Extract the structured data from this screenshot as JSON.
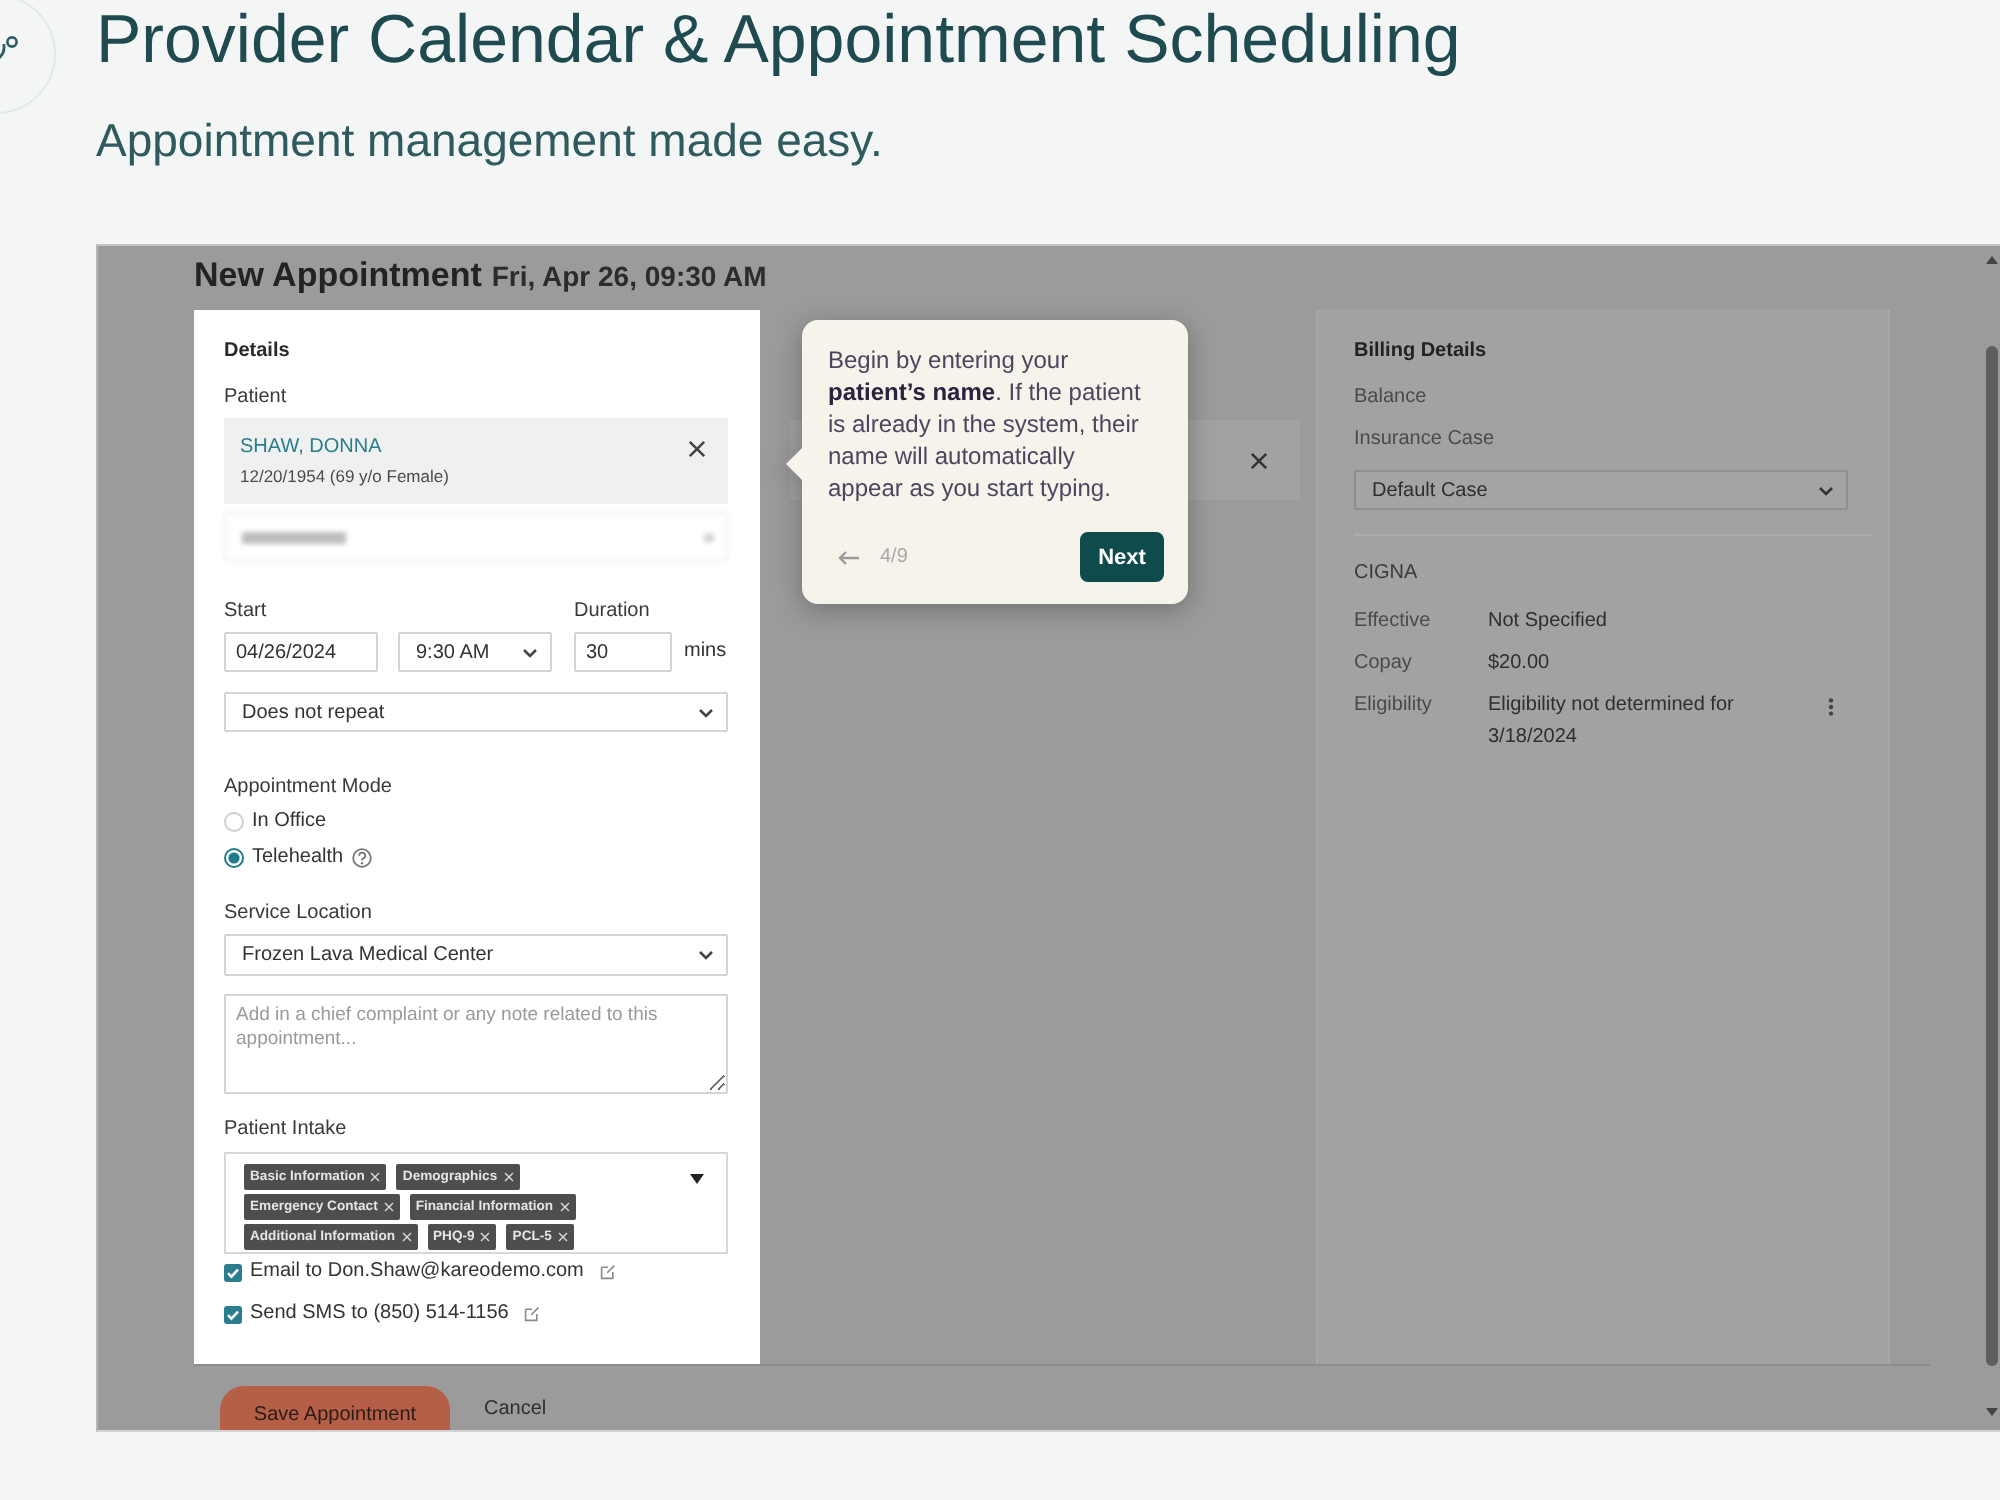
{
  "page": {
    "title": "Provider Calendar & Appointment Scheduling",
    "subtitle": "Appointment management made easy."
  },
  "screenshot": {
    "heading": "New Appointment",
    "date": "Fri, Apr 26, 09:30 AM",
    "details": {
      "title": "Details",
      "patient_label": "Patient",
      "patient": {
        "name": "SHAW, DONNA",
        "info": "12/20/1954 (69 y/o Female)"
      },
      "start_label": "Start",
      "duration_label": "Duration",
      "start_date": "04/26/2024",
      "start_time": "9:30 AM",
      "duration": "30",
      "duration_unit": "mins",
      "repeat": "Does not repeat",
      "mode_label": "Appointment Mode",
      "modes": [
        {
          "label": "In Office",
          "selected": false,
          "help": false
        },
        {
          "label": "Telehealth",
          "selected": true,
          "help": true
        }
      ],
      "location_label": "Service Location",
      "location": "Frozen Lava Medical Center",
      "note": {
        "placeholder": "Add in a chief complaint or any note related to this appointment..."
      },
      "intake_label": "Patient Intake",
      "intake_tags": [
        "Basic Information",
        "Demographics",
        "Emergency Contact",
        "Financial Information",
        "Additional Information",
        "PHQ-9",
        "PCL-5"
      ],
      "notifications": [
        {
          "label": "Email to Don.Shaw@kareodemo.com",
          "checked": true
        },
        {
          "label": "Send SMS to (850) 514-1156",
          "checked": true
        }
      ]
    },
    "billing": {
      "title": "Billing Details",
      "balance_label": "Balance",
      "insurance_case_label": "Insurance Case",
      "insurance_case": "Default Case",
      "insurer": "CIGNA",
      "rows": [
        {
          "label": "Effective",
          "value": "Not Specified",
          "menu": false
        },
        {
          "label": "Copay",
          "value": "$20.00",
          "menu": false
        },
        {
          "label": "Eligibility",
          "value": "Eligibility not determined for 3/18/2024",
          "menu": true
        }
      ]
    },
    "footer": {
      "buttons": [
        {
          "label": "Save Appointment",
          "kind": "primary"
        },
        {
          "label": "Cancel",
          "kind": "link"
        }
      ]
    }
  },
  "tooltip": {
    "text": "Begin by entering your **patient’s name**. If the patient is already in the system, their name will automatically appear as you start typing.",
    "step": "4/9",
    "button": "Next"
  }
}
